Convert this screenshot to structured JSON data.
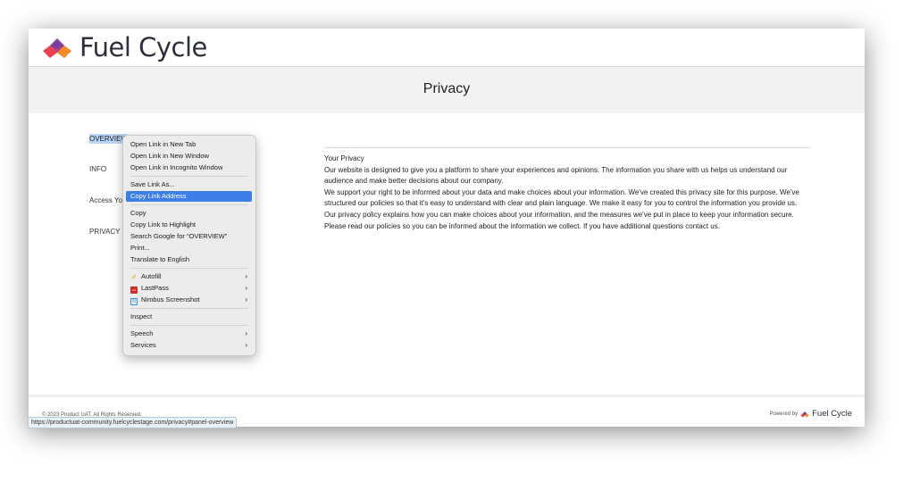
{
  "brand": {
    "name": "Fuel Cycle",
    "colors": {
      "purple": "#7b3fa0",
      "red": "#e8414f",
      "orange": "#f48a2a",
      "text": "#2d2f3c"
    }
  },
  "page": {
    "title": "Privacy"
  },
  "sidebar": {
    "items": [
      {
        "label": "OVERVIEW",
        "selected": true
      },
      {
        "label": "INFO"
      },
      {
        "label": "Access Yo"
      },
      {
        "label": "PRIVACY I"
      }
    ]
  },
  "content": {
    "heading": "Your Privacy",
    "paragraphs": [
      "Our website is designed to give you a platform to share your experiences and opinions. The information you share with us helps us understand our audience and make better decisions about our company.",
      "We support your right to be informed about your data and make choices about your information. We've created this privacy site for this purpose. We've structured our policies so that it's easy to understand with clear and plain language. We make it easy for you to control the information you provide us. Our privacy policy explains how you can make choices about your information, and the measures we've put in place to keep your information secure.",
      "Please read our policies so you can be informed about the information we collect. If you have additional questions contact us."
    ]
  },
  "footer": {
    "copyright": "© 2023 Product UAT. All Rights Reserved.",
    "powered_by": "Powered by",
    "powered_brand": "Fuel Cycle"
  },
  "status_bar": {
    "url": "https://productuat-community.fuelcyclestage.com/privacy#panel-overview"
  },
  "context_menu": {
    "items": {
      "open_new_tab": "Open Link in New Tab",
      "open_new_window": "Open Link in New Window",
      "open_incognito": "Open Link in Incognito Window",
      "save_link": "Save Link As...",
      "copy_link_address": "Copy Link Address",
      "copy": "Copy",
      "copy_link_highlight": "Copy Link to Highlight",
      "search_google": "Search Google for “OVERVIEW”",
      "print": "Print...",
      "translate": "Translate to English",
      "autofill": "Autofill",
      "lastpass": "LastPass",
      "nimbus": "Nimbus Screenshot",
      "inspect": "Inspect",
      "speech": "Speech",
      "services": "Services"
    },
    "highlighted": "Copy Link Address",
    "icons": {
      "autofill": "autofill-icon",
      "lastpass": "lastpass-icon",
      "nimbus": "nimbus-icon",
      "submenu": "chevron-right-icon"
    }
  }
}
